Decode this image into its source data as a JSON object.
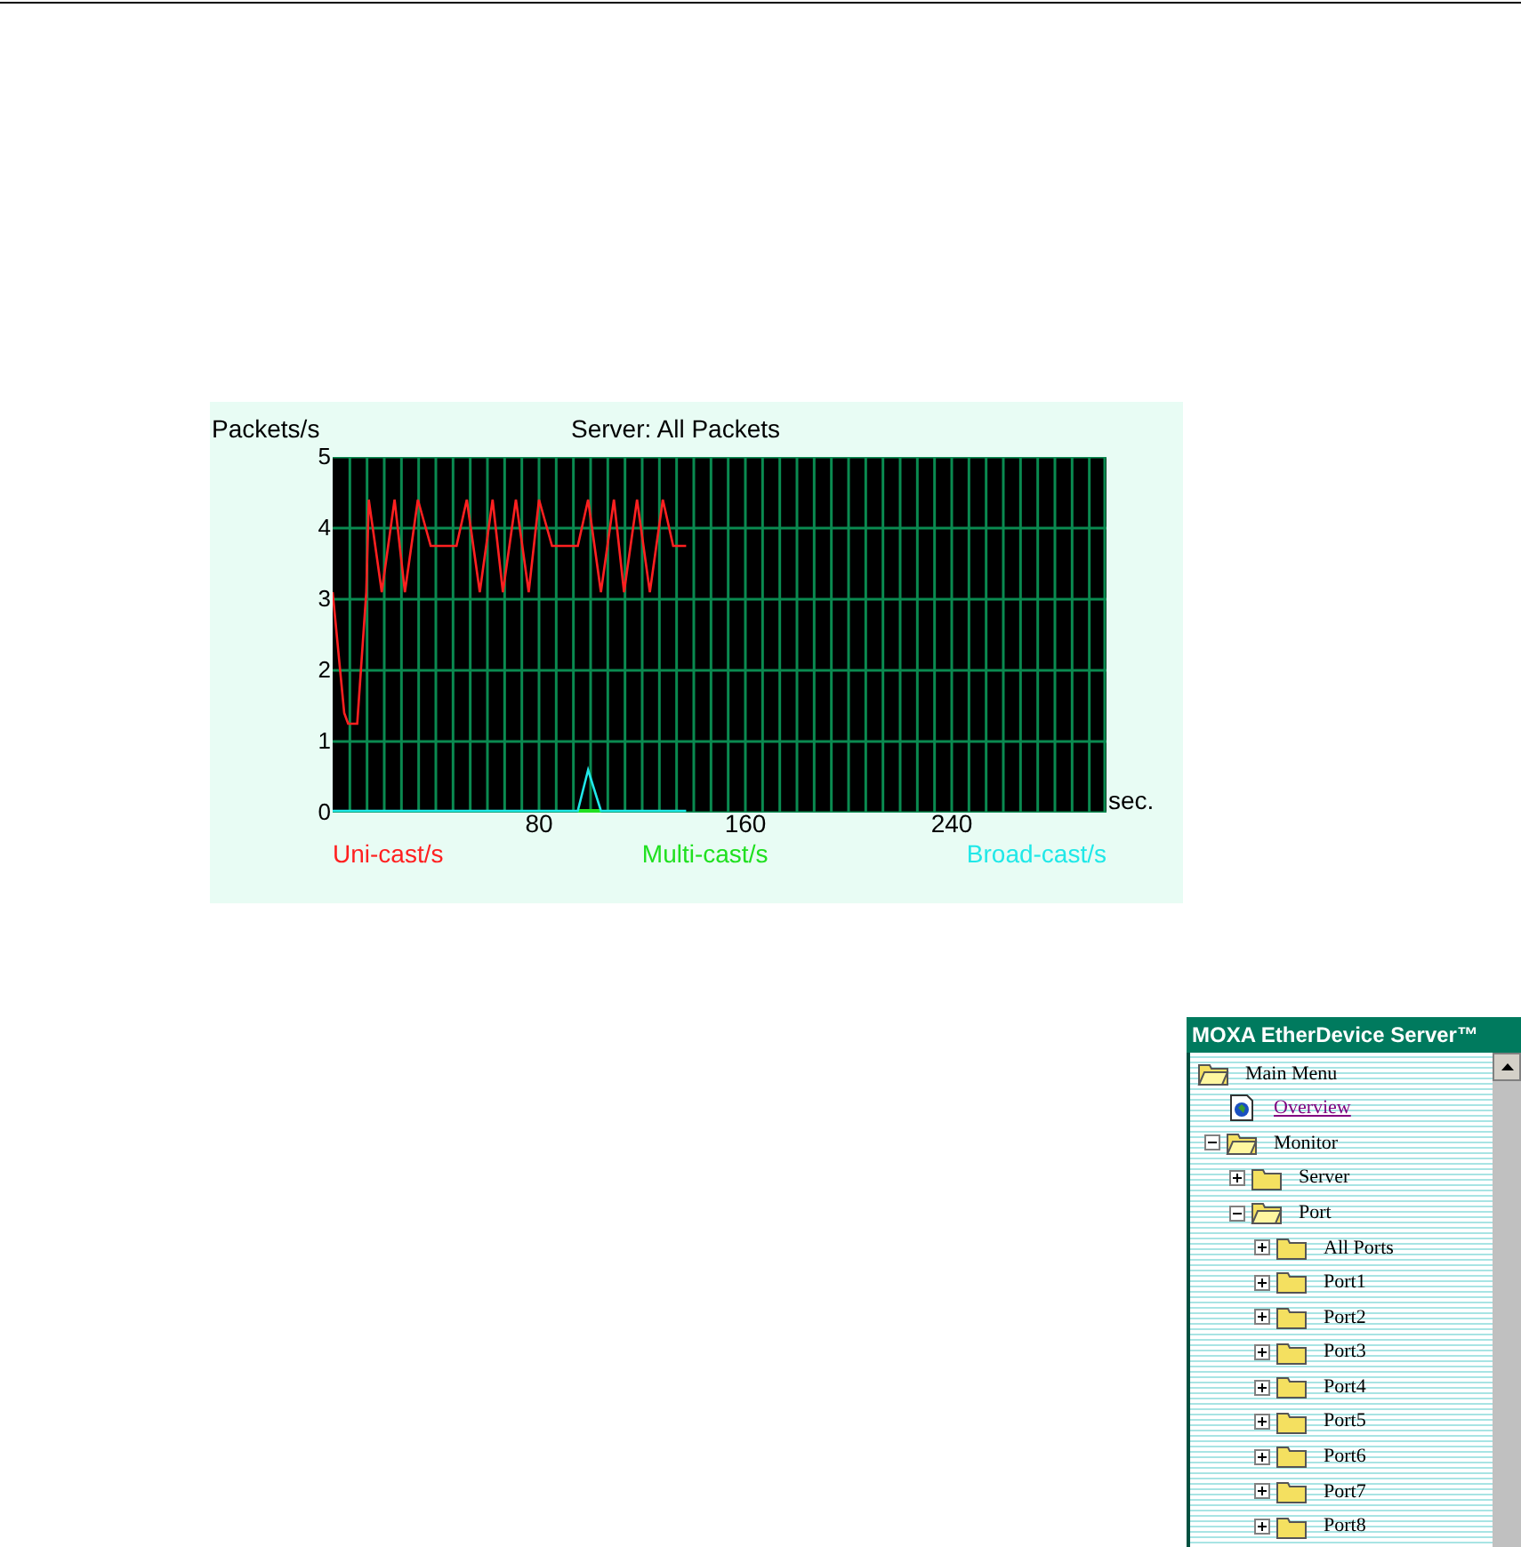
{
  "chart": {
    "chart_data": {
      "type": "line",
      "title": "Server: All Packets",
      "ylabel": "Packets/s",
      "xlabel": "sec.",
      "xlim": [
        0,
        300
      ],
      "ylim": [
        0,
        5
      ],
      "xticks": [
        80,
        160,
        240
      ],
      "yticks": [
        0,
        1,
        2,
        3,
        4,
        5
      ],
      "grid": true,
      "x": [
        0,
        4.5,
        6,
        9.5,
        13,
        14,
        19,
        24,
        28,
        33,
        38,
        48,
        52,
        57,
        62,
        66,
        71,
        76,
        80,
        85,
        94,
        95,
        99,
        104,
        109,
        113,
        118,
        123,
        128,
        132,
        137
      ],
      "series": [
        {
          "name": "Uni-cast/s",
          "color": "#ff2020",
          "values": [
            3.1,
            1.4,
            1.25,
            1.25,
            3.1,
            4.4,
            3.1,
            4.4,
            3.1,
            4.4,
            3.75,
            3.75,
            4.4,
            3.1,
            4.4,
            3.1,
            4.4,
            3.1,
            4.4,
            3.75,
            3.75,
            3.75,
            4.4,
            3.1,
            4.4,
            3.1,
            4.4,
            3.1,
            4.4,
            3.75,
            3.75
          ]
        },
        {
          "name": "Multi-cast/s",
          "color": "#20e020",
          "values": [
            null,
            null,
            null,
            null,
            null,
            null,
            null,
            null,
            null,
            null,
            null,
            null,
            null,
            null,
            null,
            null,
            null,
            null,
            null,
            null,
            null,
            0,
            0,
            0,
            null,
            null,
            null,
            null,
            null,
            null,
            null
          ]
        },
        {
          "name": "Broad-cast/s",
          "color": "#20e8e8",
          "values": [
            0,
            0,
            0,
            0,
            0,
            0,
            0,
            0,
            0,
            0,
            0,
            0,
            0,
            0,
            0,
            0,
            0,
            0,
            0,
            0,
            0,
            0,
            0.6,
            0,
            0,
            0,
            0,
            0,
            0,
            0,
            0
          ]
        }
      ]
    }
  },
  "tree": {
    "title": "MOXA EtherDevice Server™",
    "items": [
      {
        "label": "Main Menu",
        "kind": "folder",
        "children": [
          {
            "label": "Overview",
            "kind": "page"
          },
          {
            "label": "Monitor",
            "kind": "folder",
            "expanded": true,
            "children": [
              {
                "label": "Server",
                "kind": "folder",
                "expanded": false
              },
              {
                "label": "Port",
                "kind": "folder",
                "expanded": true,
                "children": [
                  {
                    "label": "All Ports",
                    "kind": "folder",
                    "expanded": false
                  },
                  {
                    "label": "Port1",
                    "kind": "folder",
                    "expanded": false
                  },
                  {
                    "label": "Port2",
                    "kind": "folder",
                    "expanded": false
                  },
                  {
                    "label": "Port3",
                    "kind": "folder",
                    "expanded": false
                  },
                  {
                    "label": "Port4",
                    "kind": "folder",
                    "expanded": false
                  },
                  {
                    "label": "Port5",
                    "kind": "folder",
                    "expanded": false
                  },
                  {
                    "label": "Port6",
                    "kind": "folder",
                    "expanded": false
                  },
                  {
                    "label": "Port7",
                    "kind": "folder",
                    "expanded": false
                  },
                  {
                    "label": "Port8",
                    "kind": "folder",
                    "expanded": false
                  }
                ]
              }
            ]
          }
        ]
      }
    ]
  }
}
